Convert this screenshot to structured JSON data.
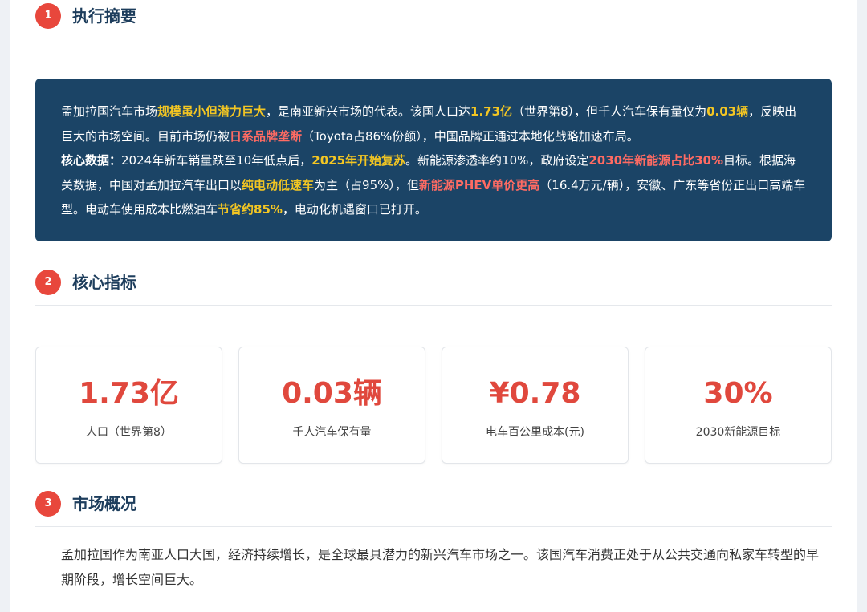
{
  "sections": [
    {
      "number": "1",
      "title": "执行摘要"
    },
    {
      "number": "2",
      "title": "核心指标"
    },
    {
      "number": "3",
      "title": "市场概况"
    }
  ],
  "summary": {
    "p1": {
      "t1": "孟加拉国汽车市场",
      "h1": "规模虽小但潜力巨大",
      "t2": "，是南亚新兴市场的代表。该国人口达",
      "h2": "1.73亿",
      "t3": "（世界第8），但千人汽车保有量仅为",
      "h3": "0.03辆",
      "t4": "，反映出巨大的市场空间。目前市场仍被",
      "h4": "日系品牌垄断",
      "t5": "（Toyota占86%份额），中国品牌正通过本地化战略加速布局。"
    },
    "p2": {
      "lead": "核心数据：",
      "t1": "2024年新车销量跌至10年低点后，",
      "h1": "2025年开始复苏",
      "t2": "。新能源渗透率约10%，政府设定",
      "h2": "2030年新能源占比30%",
      "t3": "目标。根据海关数据，中国对孟加拉汽车出口以",
      "h3": "纯电动低速车",
      "t4": "为主（占95%），但",
      "h4": "新能源PHEV单价更高",
      "t5": "（16.4万元/辆），安徽、广东等省份正出口高端车型。电动车使用成本比燃油车",
      "h5": "节省约85%",
      "t6": "，电动化机遇窗口已打开。"
    }
  },
  "metrics": [
    {
      "value": "1.73亿",
      "label": "人口（世界第8）"
    },
    {
      "value": "0.03辆",
      "label": "千人汽车保有量"
    },
    {
      "value": "¥0.78",
      "label": "电车百公里成本(元)"
    },
    {
      "value": "30%",
      "label": "2030新能源目标"
    }
  ],
  "overview": {
    "text": "孟加拉国作为南亚人口大国，经济持续增长，是全球最具潜力的新兴汽车市场之一。该国汽车消费正处于从公共交通向私家车转型的早期阶段，增长空间巨大。"
  },
  "colors": {
    "accent": "#e8473c",
    "heading": "#1d3d5c",
    "summary_bg": "#1b4466",
    "highlight_yellow": "#f3c623",
    "highlight_red": "#ff6b63",
    "metric_value": "#e0483d"
  }
}
